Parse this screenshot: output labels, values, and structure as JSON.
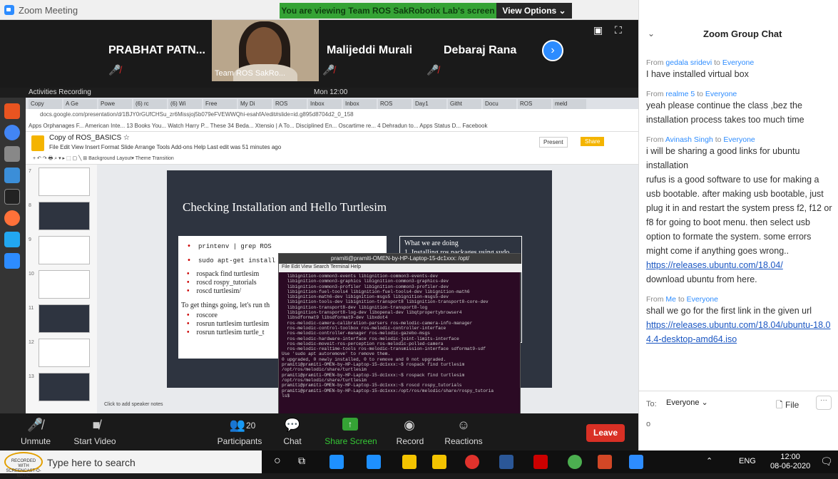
{
  "window": {
    "title": "Zoom Meeting",
    "banner": "You are viewing Team ROS SakRobotix Lab's screen",
    "view_options": "View Options ⌄"
  },
  "participants": {
    "p1": "PRABHAT  PATN...",
    "speaker_label": "Team ROS SakRo...",
    "p2": "Malijeddi Murali",
    "p3": "Debaraj Rana"
  },
  "shared": {
    "topbar_left": "Activities  Recording",
    "topbar_time": "Mon 12:00",
    "tabs": [
      "Copy",
      "A Ge",
      "Powe",
      "(6) rc",
      "(6) Wi",
      "Free",
      "My Di",
      "ROS",
      "Inbox",
      "Inbox",
      "ROS",
      "Day1",
      "Githt",
      "Docu",
      "ROS",
      "meld"
    ],
    "url": "docs.google.com/presentation/d/1BJY0rGUfCHSu_zr6Missjoj5b079eFVEWWQhi-esahfA/edit#slide=id.g895d8704d2_0_158",
    "bookmarks": "Apps   Orphanages F...   American Inte...   13 Books You...   Watch Harry P...   These 34 Beda...   Xtensio | A To...   Disciplined En...   Oscartime re...   4 Dehradun to...   Apps Status D...   Facebook",
    "doc_title": "Copy of ROS_BASICS  ☆",
    "doc_menu": "File  Edit  View  Insert  Format  Slide  Arrange  Tools  Add-ons  Help   Last edit was 51 minutes ago",
    "present": "Present",
    "share": "Share",
    "toolbar": "+  ↶ ↷ 🖶  ⌕  ▾   ▸  ⬚  ▢  ╲   ⊞   Background   Layout▾   Theme   Transition",
    "slide_title": "Checking Installation and Hello Turtlesim",
    "cmds": [
      "printenv | grep ROS",
      "sudo apt-get install ro",
      "rospack find turtlesim",
      "roscd rospy_tutorials",
      "roscd turtlesim/"
    ],
    "get_going": "To get things going, let's run th",
    "run_cmds": [
      "roscore",
      "rosrun turtlesim turtlesim",
      "rosrun turtlesim turtle_t"
    ],
    "what_title": "What we are doing",
    "what_item": "1.   Installing ros packages using sudo apt-get install",
    "term_title": "pramiti@pramiti-OMEN-by-HP-Laptop-15-dc1xxx: /opt/",
    "term_menu": "File  Edit  View  Search  Terminal  Help",
    "term_text": "  libignition-common3-events libignition-common3-events-dev\n  libignition-common3-graphics libignition-common3-graphics-dev\n  libignition-common3-profiler libignition-common3-profiler-dev\n  libignition-fuel-tools4 libignition-fuel-tools4-dev libignition-math6\n  libignition-math6-dev libignition-msgs5 libignition-msgs5-dev\n  libignition-tools-dev libignition-transport8 libignition-transport8-core-dev\n  libignition-transport8-dev libignition-transport8-log\n  libignition-transport8-log-dev libopenal-dev libqtpropertybrowser4\n  libsdformat9 libsdformat9-dev libxdot4\n  ros-melodic-camera-calibration-parsers ros-melodic-camera-info-manager\n  ros-melodic-control-toolbox ros-melodic-controller-interface\n  ros-melodic-controller-manager ros-melodic-gazebo-msgs\n  ros-melodic-hardware-interface ros-melodic-joint-limits-interface\n  ros-melodic-moveit-ros-perception ros-melodic-polled-camera\n  ros-melodic-realtime-tools ros-melodic-transmission-interface sdformat9-sdf\nUse 'sudo apt autoremove' to remove them.\n0 upgraded, 0 newly installed, 0 to remove and 0 not upgraded.\npramiti@pramiti-OMEN-by-HP-Laptop-15-dc1xxx:~$ rospack find turtlesim\n/opt/ros/melodic/share/turtlesim\npramiti@pramiti-OMEN-by-HP-Laptop-15-dc1xxx:~$ rospack find turtlesim\n/opt/ros/melodic/share/turtlesim\npramiti@pramiti-OMEN-by-HP-Laptop-15-dc1xxx:~$ roscd rospy_tutorials\npramiti@pramiti-OMEN-by-HP-Laptop-15-dc1xxx:/opt/ros/melodic/share/rospy_tutoria\nls$",
    "notes": "Click to add speaker notes",
    "thumb_nums": [
      "7",
      "8",
      "9",
      "10",
      "11",
      "12",
      "13"
    ]
  },
  "controls": {
    "unmute": "Unmute",
    "video": "Start Video",
    "participants": "Participants",
    "participants_count": "20",
    "chat": "Chat",
    "share": "Share Screen",
    "record": "Record",
    "reactions": "Reactions",
    "leave": "Leave"
  },
  "chat": {
    "title": "Zoom Group Chat",
    "messages": [
      {
        "from": "gedala sridevi",
        "to": "Everyone",
        "text": "I have installed virtual box"
      },
      {
        "from": "realme 5",
        "to": "Everyone",
        "text": "yeah please continue the class ,bez the installation process takes too much time"
      },
      {
        "from": "Avinash Singh",
        "to": "Everyone",
        "text": "i will be sharing a good links for ubuntu installation\nrufus is a good software to use for making a usb bootable. after making usb bootable, just plug it in and restart the system press f2, f12 or f8 for going to boot menu. then select usb option to formate the system. some errors might come if anything goes wrong..",
        "link": "https://releases.ubuntu.com/18.04/",
        "after": "download ubuntu from here."
      },
      {
        "from": "Me",
        "to": "Everyone",
        "text": "shall we go for the first link in the given url",
        "link": "https://releases.ubuntu.com/18.04/ubuntu-18.04.4-desktop-amd64.iso"
      }
    ],
    "from_word": "From",
    "to_word": "to",
    "to_label": "To:",
    "to_value": "Everyone ⌄",
    "file": "File",
    "input": "o"
  },
  "taskbar": {
    "search": "Type here to search",
    "watermark": "RECORDED WITH SCREENCAST-O-MATIC",
    "lang": "ENG",
    "time": "12:00",
    "date": "08-06-2020"
  },
  "colors": {
    "zoom_blue": "#2d8cff",
    "banner_green": "#35a335",
    "leave_red": "#d93025",
    "slide_bg": "#2e3440",
    "terminal_bg": "#2b0a24"
  }
}
